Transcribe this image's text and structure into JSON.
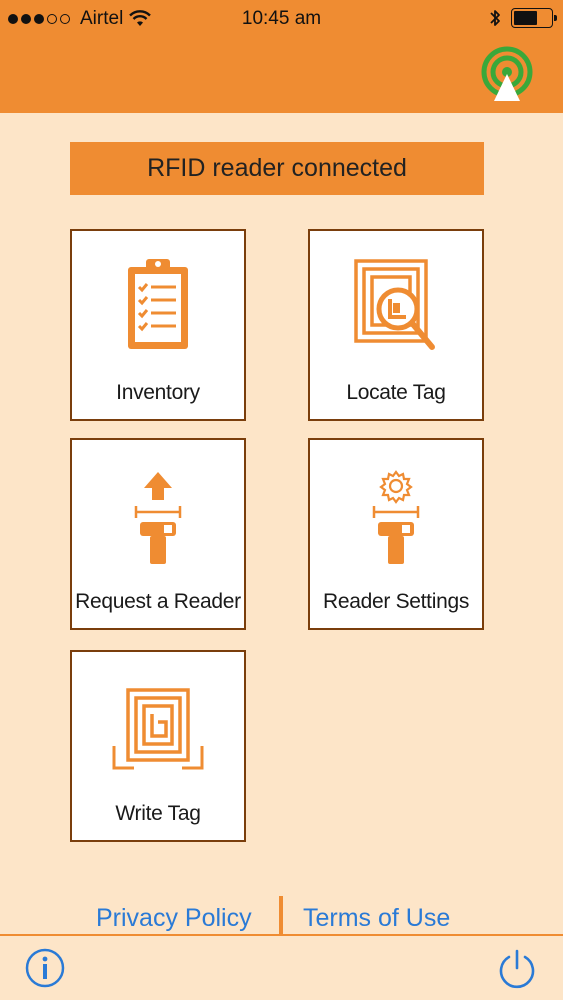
{
  "status_bar": {
    "carrier": "Airtel",
    "time": "10:45 am",
    "signal_bars_filled": 3,
    "signal_bars_total": 5,
    "battery_level_percent": 65,
    "icons": [
      "wifi-icon",
      "bluetooth-icon",
      "battery-icon"
    ]
  },
  "header": {
    "reader_status_icon": "rfid-antenna-icon",
    "reader_status_color": "#3aa83a"
  },
  "banner": {
    "text": "RFID reader connected"
  },
  "tiles": [
    {
      "label": "Inventory",
      "icon": "clipboard-checklist-icon"
    },
    {
      "label": "Locate Tag",
      "icon": "locate-tag-icon"
    },
    {
      "label": "Request a Reader",
      "icon": "request-reader-icon"
    },
    {
      "label": "Reader Settings",
      "icon": "reader-settings-icon"
    },
    {
      "label": "Write Tag",
      "icon": "write-tag-icon"
    }
  ],
  "footer": {
    "privacy_policy": "Privacy Policy",
    "terms_of_use": "Terms of Use",
    "info_icon": "info-icon",
    "power_icon": "power-icon"
  },
  "colors": {
    "accent": "#ef8c32",
    "background": "#fde5c8",
    "link": "#2a7ad6"
  }
}
